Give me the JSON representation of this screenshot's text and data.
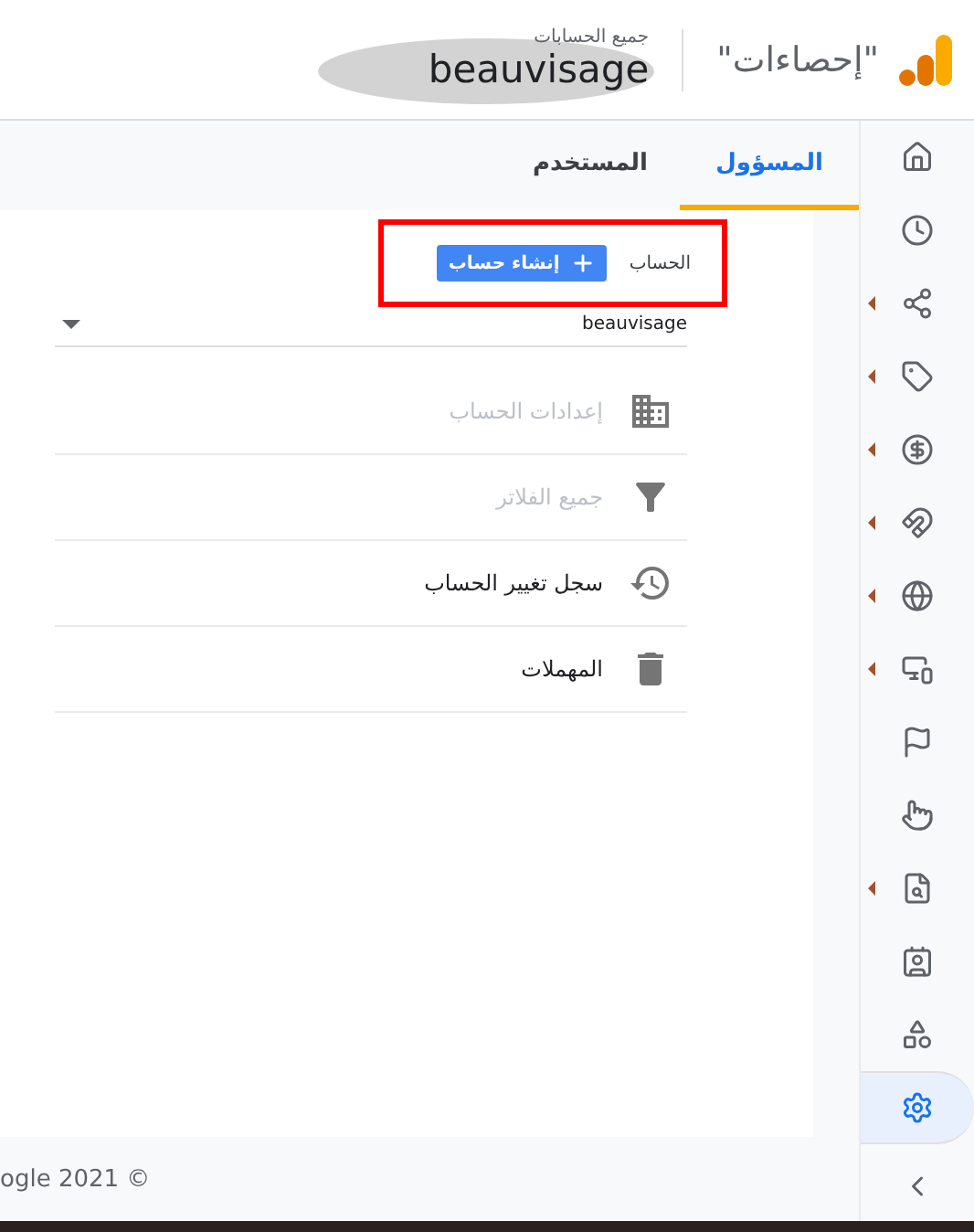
{
  "header": {
    "product_title": "\"إحصاءات\"",
    "breadcrumb": "جميع الحسابات",
    "account": "beauvisage"
  },
  "sidebar": {
    "items": [
      {
        "kind": "home",
        "has_submenu": false,
        "selected": false
      },
      {
        "kind": "clock",
        "has_submenu": false,
        "selected": false
      },
      {
        "kind": "nodes",
        "has_submenu": true,
        "selected": false
      },
      {
        "kind": "tag",
        "has_submenu": true,
        "selected": false
      },
      {
        "kind": "dollar",
        "has_submenu": true,
        "selected": false
      },
      {
        "kind": "magnet",
        "has_submenu": true,
        "selected": false
      },
      {
        "kind": "globe",
        "has_submenu": true,
        "selected": false
      },
      {
        "kind": "devices",
        "has_submenu": true,
        "selected": false
      },
      {
        "kind": "flag",
        "has_submenu": false,
        "selected": false
      },
      {
        "kind": "touch",
        "has_submenu": false,
        "selected": false
      },
      {
        "kind": "report",
        "has_submenu": true,
        "selected": false
      },
      {
        "kind": "people",
        "has_submenu": false,
        "selected": false
      },
      {
        "kind": "shapes",
        "has_submenu": false,
        "selected": false
      },
      {
        "kind": "settings",
        "has_submenu": false,
        "selected": true
      }
    ]
  },
  "tabs": [
    {
      "label": "المسؤول",
      "selected": true
    },
    {
      "label": "المستخدم",
      "selected": false
    }
  ],
  "account_column": {
    "label": "الحساب",
    "create_button": "إنشاء حساب",
    "highlighted": true,
    "selector_value": "beauvisage",
    "menu": [
      {
        "kind": "building",
        "label": "إعدادات الحساب",
        "disabled": true
      },
      {
        "kind": "filter",
        "label": "جميع الفلاتر",
        "disabled": true
      },
      {
        "kind": "history",
        "label": "سجل تغيير الحساب",
        "disabled": false
      },
      {
        "kind": "trash",
        "label": "المهملات",
        "disabled": false
      }
    ]
  },
  "footer": "ogle 2021 ©"
}
